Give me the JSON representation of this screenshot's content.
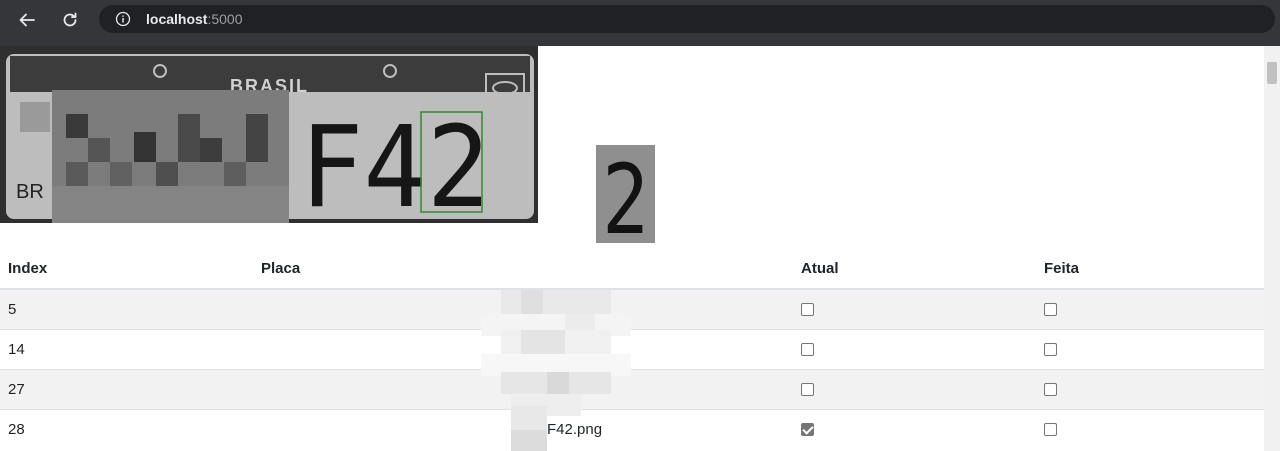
{
  "browser": {
    "url_host": "localhost",
    "url_port": ":5000",
    "icons": {
      "back": "arrow-left-icon",
      "reload": "reload-icon",
      "info": "info-circle-icon"
    }
  },
  "images": {
    "plate": {
      "country_text": "BRASIL",
      "country_code": "BR",
      "visible_chars": "F42"
    },
    "crop": {
      "char": "2"
    }
  },
  "table": {
    "headers": [
      "Index",
      "Placa",
      "Atual",
      "Feita"
    ],
    "rows": [
      {
        "index": "5",
        "placa": "",
        "atual": false,
        "feita": false
      },
      {
        "index": "14",
        "placa": "",
        "atual": false,
        "feita": false
      },
      {
        "index": "27",
        "placa": "",
        "atual": false,
        "feita": false
      },
      {
        "index": "28",
        "placa": "F42.png",
        "atual": true,
        "feita": false
      }
    ]
  },
  "colors": {
    "toolbar": "#35363a",
    "omnibox": "#202124",
    "row_stripe": "#f2f2f2",
    "plate_bg": "#c8c8c8",
    "bbox": "#2e8b2e"
  }
}
